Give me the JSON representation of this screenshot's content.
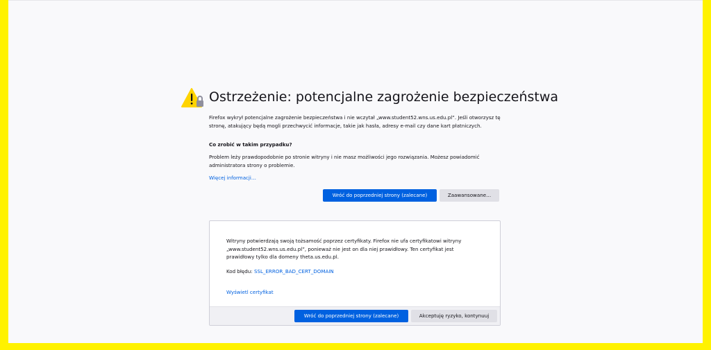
{
  "warning": {
    "title": "Ostrzeżenie: potencjalne zagrożenie bezpieczeństwa",
    "description": "Firefox wykrył potencjalne zagrożenie bezpieczeństwa i nie wczytał „www.student52.wns.us.edu.pl”. Jeśli otworzysz tę stronę, atakujący będą mogli przechwycić informacje, takie jak hasła, adresy e-mail czy dane kart płatniczych.",
    "what_to_do_heading": "Co zrobić w takim przypadku?",
    "what_to_do_text": "Problem leży prawdopodobnie po stronie witryny i nie masz możliwości jego rozwiązania. Możesz powiadomić administratora strony o problemie.",
    "more_info_link": "Więcej informacji…",
    "go_back_button": "Wróć do poprzedniej strony (zalecane)",
    "advanced_button": "Zaawansowane…"
  },
  "advanced_panel": {
    "text": "Witryny potwierdzają swoją tożsamość poprzez certyfikaty. Firefox nie ufa certyfikatowi witryny „www.student52.wns.us.edu.pl”, ponieważ nie jest on dla niej prawidłowy. Ten certyfikat jest prawidłowy tylko dla domeny theta.us.edu.pl.",
    "error_code_label": "Kod błędu: ",
    "error_code": "SSL_ERROR_BAD_CERT_DOMAIN",
    "view_certificate_link": "Wyświetl certyfikat",
    "go_back_button": "Wróć do poprzedniej strony (zalecane)",
    "accept_risk_button": "Akceptuję ryzyko, kontynuuj"
  },
  "colors": {
    "frame": "#fff200",
    "primary_button": "#0061e0",
    "link": "#0061e0",
    "warning_icon": "#ffd400"
  },
  "icons": {
    "warning": "warning-triangle-lock-icon"
  }
}
